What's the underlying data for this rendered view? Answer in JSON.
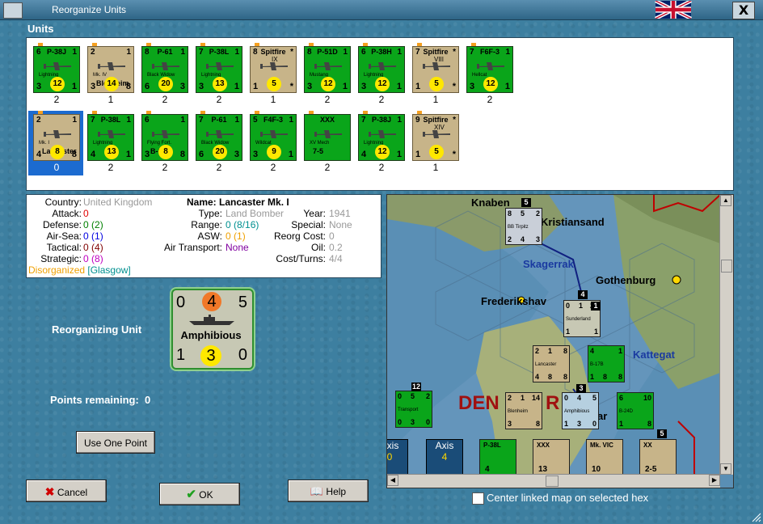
{
  "window": {
    "title": "Reorganize Units",
    "close_label": "X"
  },
  "units_section": {
    "label": "Units"
  },
  "units_row1": [
    {
      "name": "P-38J",
      "tl": "6",
      "tr": "1",
      "bl": "3",
      "mid": "12",
      "br": "1",
      "sub": "Lightning",
      "count": "2",
      "color": "green"
    },
    {
      "name": "",
      "tl": "2",
      "tr": "1",
      "bl": "3",
      "mid": "14",
      "br": "8",
      "sub": "Mk. IV",
      "label": "Blenheim",
      "count": "1",
      "color": "tan"
    },
    {
      "name": "P-61",
      "tl": "8",
      "tr": "1",
      "bl": "6",
      "mid": "20",
      "br": "3",
      "sub": "Black Widow",
      "count": "2",
      "color": "green"
    },
    {
      "name": "P-38L",
      "tl": "7",
      "tr": "1",
      "bl": "3",
      "mid": "13",
      "br": "1",
      "sub": "Lightning",
      "count": "2",
      "color": "green"
    },
    {
      "name": "Spitfire",
      "sub2": "IX",
      "tl": "8",
      "tr": "*",
      "bl": "1",
      "mid": "5",
      "br": "*",
      "sub": "",
      "count": "1",
      "color": "tan"
    },
    {
      "name": "P-51D",
      "tl": "8",
      "tr": "1",
      "bl": "3",
      "mid": "12",
      "br": "1",
      "sub": "Mustang",
      "count": "2",
      "color": "green"
    },
    {
      "name": "P-38H",
      "tl": "6",
      "tr": "1",
      "bl": "3",
      "mid": "12",
      "br": "1",
      "sub": "Lightning",
      "count": "2",
      "color": "green"
    },
    {
      "name": "Spitfire",
      "sub2": "VIII",
      "tl": "7",
      "tr": "*",
      "bl": "1",
      "mid": "5",
      "br": "*",
      "sub": "",
      "count": "1",
      "color": "tan"
    },
    {
      "name": "F6F-3",
      "tl": "7",
      "tr": "1",
      "bl": "3",
      "mid": "12",
      "br": "1",
      "sub": "Hellcat",
      "count": "2",
      "color": "green"
    }
  ],
  "units_row2": [
    {
      "name": "",
      "tl": "2",
      "tr": "1",
      "bl": "4",
      "mid": "8",
      "br": "8",
      "sub": "Mk. I",
      "label": "Lancaster",
      "count": "0",
      "color": "tan",
      "selected": true
    },
    {
      "name": "P-38L",
      "tl": "7",
      "tr": "1",
      "bl": "4",
      "mid": "13",
      "br": "1",
      "sub": "Lightning",
      "count": "2",
      "color": "green"
    },
    {
      "name": "",
      "tl": "6",
      "tr": "1",
      "bl": "3",
      "mid": "8",
      "br": "8",
      "sub": "Flying Fort.",
      "label": "B-17F",
      "count": "2",
      "color": "green"
    },
    {
      "name": "P-61",
      "tl": "7",
      "tr": "1",
      "bl": "6",
      "mid": "20",
      "br": "3",
      "sub": "Black Widow",
      "count": "2",
      "color": "green"
    },
    {
      "name": "F4F-3",
      "tl": "5",
      "tr": "1",
      "bl": "3",
      "mid": "9",
      "br": "1",
      "sub": "Wildcat",
      "count": "2",
      "color": "green"
    },
    {
      "name": "XXX",
      "tl": "",
      "tr": "",
      "bl": "",
      "mid": "",
      "br": "",
      "sub": "XV Mech",
      "label": "7-5",
      "count": "2",
      "color": "green"
    },
    {
      "name": "P-38J",
      "tl": "7",
      "tr": "1",
      "bl": "4",
      "mid": "12",
      "br": "1",
      "sub": "Lightning",
      "count": "2",
      "color": "green"
    },
    {
      "name": "Spitfire",
      "sub2": "XIV",
      "tl": "9",
      "tr": "*",
      "bl": "1",
      "mid": "5",
      "br": "*",
      "sub": "",
      "count": "1",
      "color": "tan"
    }
  ],
  "info": {
    "country_label": "Country:",
    "country": "United Kingdom",
    "attack_label": "Attack:",
    "attack": "0",
    "defense_label": "Defense:",
    "defense": "0",
    "defense2": "(2)",
    "airsea_label": "Air-Sea:",
    "airsea": "0",
    "airsea2": "(1)",
    "tactical_label": "Tactical:",
    "tactical": "0",
    "tactical2": "(4)",
    "strategic_label": "Strategic:",
    "strategic": "0",
    "strategic2": "(8)",
    "status": "Disorganized",
    "location": "[Glasgow]",
    "name_label": "Name:",
    "name": "Lancaster Mk. I",
    "type_label": "Type:",
    "type": "Land Bomber",
    "year_label": "Year:",
    "year": "1941",
    "range_label": "Range:",
    "range": "0",
    "range2": "(8/16)",
    "special_label": "Special:",
    "special": "None",
    "asw_label": "ASW:",
    "asw": "0",
    "asw2": "(1)",
    "reorg_label": "Reorg Cost:",
    "reorg": "0",
    "airtransport_label": "Air Transport:",
    "airtransport": "None",
    "oil_label": "Oil:",
    "oil": "0.2",
    "costturns_label": "Cost/Turns:",
    "costturns": "4/4"
  },
  "reorganizing": {
    "label": "Reorganizing Unit",
    "counter": {
      "tl": "0",
      "tc": "4",
      "tr": "5",
      "name": "Amphibious",
      "bl": "1",
      "bc": "3",
      "br": "0"
    }
  },
  "points": {
    "label": "Points remaining:",
    "value": "0"
  },
  "buttons": {
    "use_one_point": "Use One Point",
    "cancel": "Cancel",
    "ok": "OK",
    "help": "Help"
  },
  "map": {
    "labels": [
      "Knaben",
      "Kristiansand",
      "Skagerrak",
      "Gothenburg",
      "Frederikshav",
      "Kattegat",
      "DEN",
      "R",
      "ar"
    ],
    "counters": [
      {
        "label": "BB Tirpitz",
        "tl": "8",
        "tc": "5",
        "tr": "2",
        "bl": "2",
        "bc": "4",
        "br": "3"
      },
      {
        "label": "Sunderland",
        "tl": "0",
        "tc": "1",
        "tr": "20",
        "bl": "1",
        "bc": "",
        "br": "1"
      },
      {
        "label": "Lancaster",
        "tl": "2",
        "tc": "1",
        "tr": "8",
        "bl": "4",
        "bc": "8",
        "br": "8"
      },
      {
        "label": "B-17B",
        "tl": "4",
        "tc": "",
        "tr": "1",
        "bl": "1",
        "bc": "8",
        "br": "8"
      },
      {
        "label": "Transport",
        "tl": "0",
        "tc": "5",
        "tr": "2",
        "bl": "0",
        "bc": "3",
        "br": "0"
      },
      {
        "label": "Blenheim",
        "tl": "2",
        "tc": "1",
        "tr": "14",
        "bl": "3",
        "bc": "",
        "br": "8"
      },
      {
        "label": "Amphibious",
        "tl": "0",
        "tc": "4",
        "tr": "5",
        "bl": "1",
        "bc": "3",
        "br": "0"
      },
      {
        "label": "B-24D",
        "tl": "6",
        "tc": "",
        "tr": "10",
        "bl": "1",
        "bc": "",
        "br": "8"
      }
    ],
    "badges": [
      "5",
      "4",
      "3",
      "12",
      "1",
      "5"
    ],
    "axis_boxes": [
      {
        "label": "Axis",
        "value": "0"
      },
      {
        "label": "Axis",
        "value": "4"
      }
    ],
    "bottom_counters": [
      "P-38L",
      "XXX",
      "Mk. VIC",
      "XX"
    ],
    "bottom_values": [
      "4",
      "13",
      "10",
      "2-5"
    ]
  },
  "center_linked": {
    "label": "Center linked map on selected hex",
    "checked": false
  },
  "colors": {
    "window_bg": "#3d7fa0",
    "counter_green": "#0aa51a",
    "counter_tan": "#c7b489",
    "selection": "#1c6bd0"
  }
}
